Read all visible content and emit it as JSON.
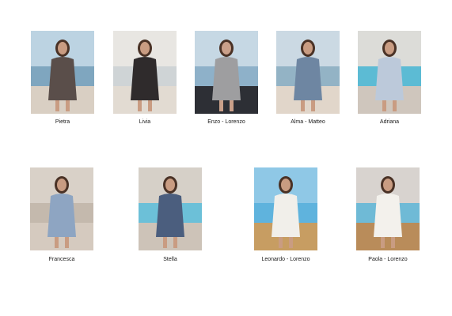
{
  "looks": [
    {
      "label": "Pietra",
      "palette": {
        "sky": "#bcd3e2",
        "sea": "#7fa6bf",
        "ground": "#d9cfc3",
        "garment": "#5a4e4a",
        "skin": "#c99c82",
        "hair": "#4a3226"
      }
    },
    {
      "label": "Livia",
      "palette": {
        "sky": "#e8e6e2",
        "sea": "#cfd4d6",
        "ground": "#e2dbd2",
        "garment": "#2f2b2c",
        "skin": "#c99c82",
        "hair": "#4a3226"
      }
    },
    {
      "label": "Enzo - Lorenzo",
      "palette": {
        "sky": "#c6d8e4",
        "sea": "#8eb1c9",
        "ground": "#2d2f35",
        "garment": "#9e9ea0",
        "skin": "#caa08a",
        "hair": "#4a3226"
      }
    },
    {
      "label": "Alma - Matteo",
      "palette": {
        "sky": "#cbd9e3",
        "sea": "#93b3c5",
        "ground": "#e1d6ca",
        "garment": "#6e86a2",
        "skin": "#c99c82",
        "hair": "#4a3226"
      }
    },
    {
      "label": "Adriana",
      "palette": {
        "sky": "#dcdcd8",
        "sea": "#5cbbd4",
        "ground": "#cfc6bd",
        "garment": "#bcc9da",
        "skin": "#c99c82",
        "hair": "#4a3226"
      }
    },
    {
      "label": "Francesca",
      "palette": {
        "sky": "#d9d1c8",
        "sea": "#c4b9ad",
        "ground": "#d5cabf",
        "garment": "#8ea5c2",
        "skin": "#c99c82",
        "hair": "#4a3226"
      }
    },
    {
      "label": "Stella",
      "palette": {
        "sky": "#d6d0c8",
        "sea": "#6cc0d8",
        "ground": "#cdc3b8",
        "garment": "#4b5e7e",
        "skin": "#c99c82",
        "hair": "#4a3226"
      }
    },
    {
      "label": "Leonardo - Lorenzo",
      "palette": {
        "sky": "#8fc8e6",
        "sea": "#5fb3dd",
        "ground": "#c79d62",
        "garment": "#f1efea",
        "skin": "#c99c82",
        "hair": "#4a3226"
      }
    },
    {
      "label": "Paola - Lorenzo",
      "palette": {
        "sky": "#d8d3cf",
        "sea": "#6fbad6",
        "ground": "#b98c5a",
        "garment": "#f3f1ec",
        "skin": "#c99c82",
        "hair": "#4a3226"
      }
    }
  ]
}
